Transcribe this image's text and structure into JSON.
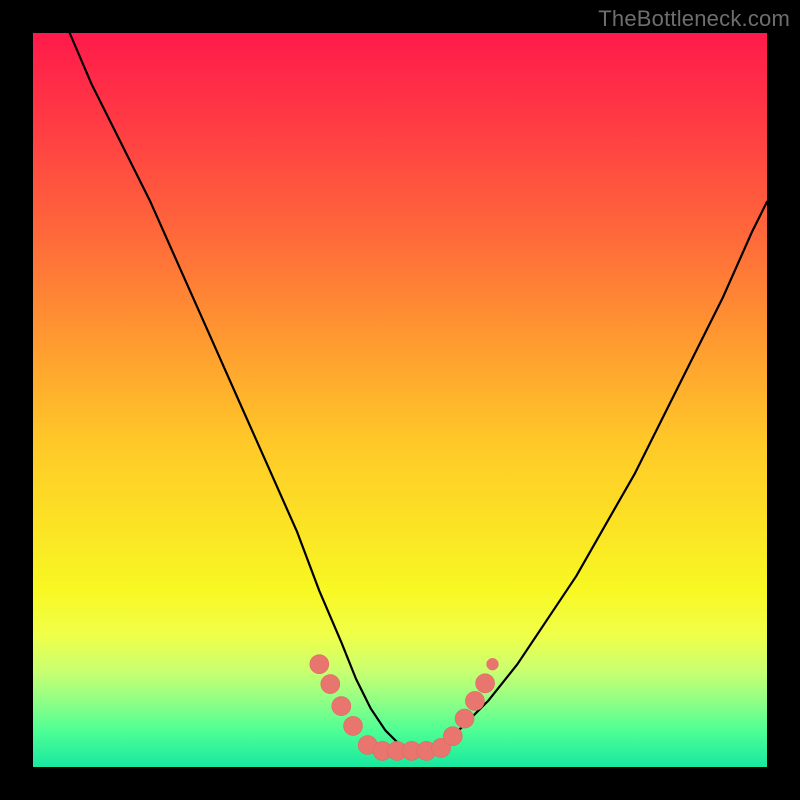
{
  "watermark": "TheBottleneck.com",
  "colors": {
    "page_bg": "#000000",
    "gradient_top": "#ff1a4b",
    "gradient_bottom": "#18e8a0",
    "curve": "#000000",
    "dots": "#e9766e"
  },
  "chart_data": {
    "type": "line",
    "title": "",
    "xlabel": "",
    "ylabel": "",
    "xlim": [
      0,
      100
    ],
    "ylim": [
      0,
      100
    ],
    "grid": false,
    "legend": false,
    "background": "vertical-gradient red→yellow→green",
    "series": [
      {
        "name": "bottleneck-curve",
        "x": [
          5,
          8,
          12,
          16,
          20,
          24,
          28,
          32,
          36,
          39,
          42,
          44,
          46,
          48,
          50,
          52,
          54,
          56,
          58,
          62,
          66,
          70,
          74,
          78,
          82,
          86,
          90,
          94,
          98,
          100
        ],
        "y": [
          100,
          93,
          85,
          77,
          68,
          59,
          50,
          41,
          32,
          24,
          17,
          12,
          8,
          5,
          3,
          2,
          2,
          3,
          5,
          9,
          14,
          20,
          26,
          33,
          40,
          48,
          56,
          64,
          73,
          77
        ]
      }
    ],
    "markers": [
      {
        "x": 39.0,
        "y": 14.0,
        "r": 1.3
      },
      {
        "x": 40.5,
        "y": 11.3,
        "r": 1.3
      },
      {
        "x": 42.0,
        "y": 8.3,
        "r": 1.3
      },
      {
        "x": 43.6,
        "y": 5.6,
        "r": 1.3
      },
      {
        "x": 45.6,
        "y": 3.0,
        "r": 1.3
      },
      {
        "x": 47.6,
        "y": 2.2,
        "r": 1.3
      },
      {
        "x": 49.6,
        "y": 2.2,
        "r": 1.3
      },
      {
        "x": 51.6,
        "y": 2.2,
        "r": 1.3
      },
      {
        "x": 53.6,
        "y": 2.2,
        "r": 1.3
      },
      {
        "x": 55.6,
        "y": 2.6,
        "r": 1.3
      },
      {
        "x": 57.2,
        "y": 4.2,
        "r": 1.3
      },
      {
        "x": 58.8,
        "y": 6.6,
        "r": 1.3
      },
      {
        "x": 60.2,
        "y": 9.0,
        "r": 1.3
      },
      {
        "x": 61.6,
        "y": 11.4,
        "r": 1.3
      },
      {
        "x": 62.6,
        "y": 14.0,
        "r": 0.8
      }
    ]
  }
}
